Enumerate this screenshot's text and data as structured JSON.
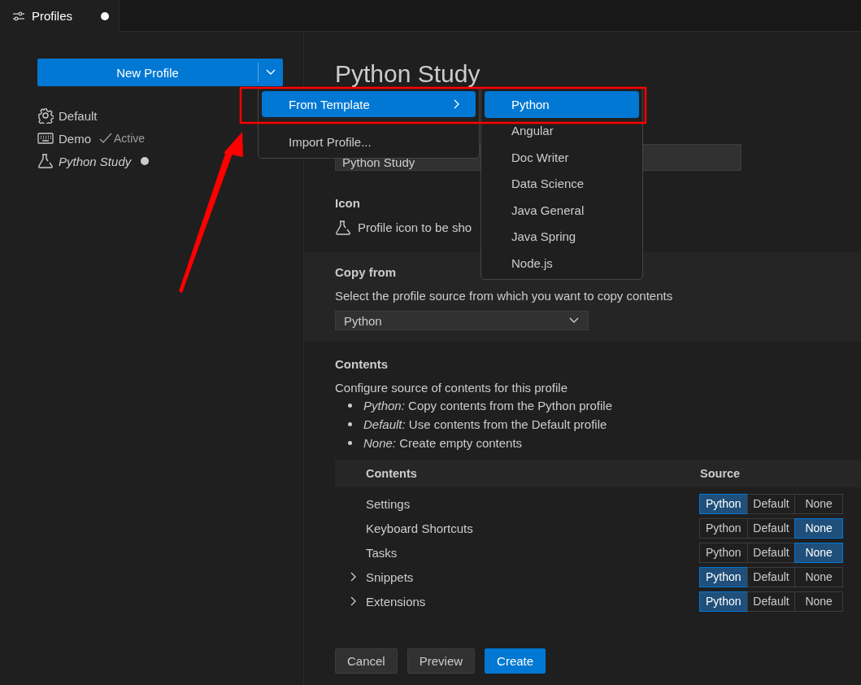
{
  "tab": {
    "title": "Profiles",
    "dirty": true
  },
  "sidebar": {
    "new_profile_button": "New Profile",
    "profiles": [
      {
        "name": "Default",
        "kind": "gear",
        "editing": false
      },
      {
        "name": "Demo",
        "kind": "keyboard",
        "active_label": "Active",
        "editing": false
      },
      {
        "name": "Python Study",
        "kind": "flask",
        "editing": true
      }
    ]
  },
  "menu": {
    "items": [
      {
        "label": "From Template",
        "selected": true,
        "submenu": true
      },
      {
        "label": "Import Profile...",
        "selected": false,
        "submenu": false
      }
    ],
    "submenu": [
      {
        "label": "Python",
        "selected": true
      },
      {
        "label": "Angular",
        "selected": false
      },
      {
        "label": "Doc Writer",
        "selected": false
      },
      {
        "label": "Data Science",
        "selected": false
      },
      {
        "label": "Java General",
        "selected": false
      },
      {
        "label": "Java Spring",
        "selected": false
      },
      {
        "label": "Node.js",
        "selected": false
      }
    ]
  },
  "main": {
    "title": "Python Study",
    "name_field": "Python Study",
    "icon_section": {
      "label": "Icon",
      "description": "Profile icon to be sho"
    },
    "copy_from": {
      "label": "Copy from",
      "description": "Select the profile source from which you want to copy contents",
      "value": "Python"
    },
    "contents": {
      "label": "Contents",
      "description": "Configure source of contents for this profile",
      "bullets": [
        "*Python:* Copy contents from the Python profile",
        "*Default:* Use contents from the Default profile",
        "*None:* Create empty contents"
      ]
    },
    "table": {
      "columns": [
        "Contents",
        "Source"
      ],
      "rows": [
        {
          "label": "Settings",
          "expandable": false,
          "options": [
            {
              "label": "Python",
              "selected": true
            },
            {
              "label": "Default",
              "selected": false
            },
            {
              "label": "None",
              "selected": false
            }
          ]
        },
        {
          "label": "Keyboard Shortcuts",
          "expandable": false,
          "options": [
            {
              "label": "Python",
              "selected": false
            },
            {
              "label": "Default",
              "selected": false
            },
            {
              "label": "None",
              "selected": true
            }
          ]
        },
        {
          "label": "Tasks",
          "expandable": false,
          "options": [
            {
              "label": "Python",
              "selected": false
            },
            {
              "label": "Default",
              "selected": false
            },
            {
              "label": "None",
              "selected": true
            }
          ]
        },
        {
          "label": "Snippets",
          "expandable": true,
          "options": [
            {
              "label": "Python",
              "selected": true
            },
            {
              "label": "Default",
              "selected": false
            },
            {
              "label": "None",
              "selected": false
            }
          ]
        },
        {
          "label": "Extensions",
          "expandable": true,
          "options": [
            {
              "label": "Python",
              "selected": true
            },
            {
              "label": "Default",
              "selected": false
            },
            {
              "label": "None",
              "selected": false
            }
          ]
        }
      ]
    },
    "buttons": [
      {
        "label": "Cancel",
        "primary": false
      },
      {
        "label": "Preview",
        "primary": false
      },
      {
        "label": "Create",
        "primary": true
      }
    ]
  }
}
